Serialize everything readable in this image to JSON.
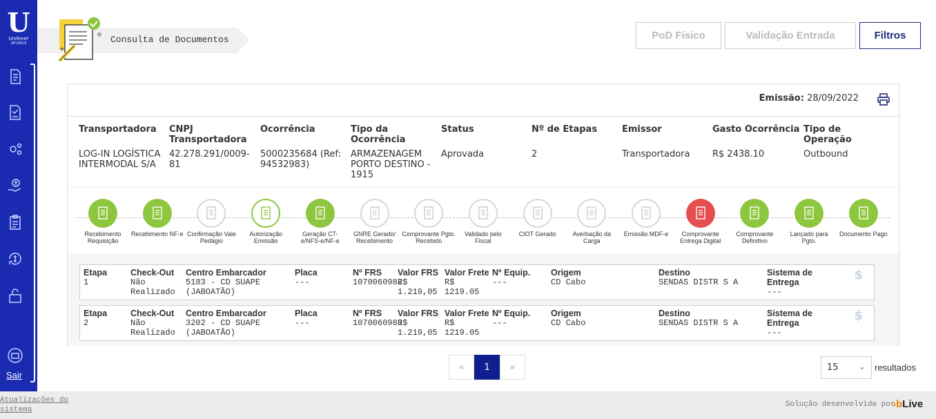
{
  "brand": {
    "name": "Unilever",
    "sub": "UP-DOCS",
    "letter": "U"
  },
  "sidebar": {
    "icons": [
      "document-icon",
      "document-check-icon",
      "gears-icon",
      "money-hand-icon",
      "clipboard-icon",
      "currency-cycle-icon",
      "unlock-icon",
      "robot-icon"
    ],
    "exit_label": "Sair"
  },
  "header": {
    "breadcrumb": "Consulta de Documentos",
    "buttons": {
      "pod": "PoD Físico",
      "validacao": "Validação Entrada",
      "filtros": "Filtros"
    }
  },
  "emission": {
    "label": "Emissão:",
    "value": "28/09/2022"
  },
  "info": [
    {
      "h": "Transportadora",
      "v": "LOG-IN LOGÍSTICA INTERMODAL S/A"
    },
    {
      "h": "CNPJ Transportadora",
      "v": "42.278.291/0009-81"
    },
    {
      "h": "Ocorrência",
      "v": "5000235684 (Ref: 94532983)"
    },
    {
      "h": "Tipo da Ocorrência",
      "v": "ARMAZENAGEM PORTO DESTINO - 1915"
    },
    {
      "h": "Status",
      "v": "Aprovada"
    },
    {
      "h": "Nº de Etapas",
      "v": "2"
    },
    {
      "h": "Emissor",
      "v": "Transportadora"
    },
    {
      "h": "Gasto Ocorrência",
      "v": "R$ 2438.10"
    },
    {
      "h": "Tipo de Operação",
      "v": "Outbound"
    }
  ],
  "steps": [
    {
      "label": "Recebimento Requisição",
      "state": "done"
    },
    {
      "label": "Recebimento NF-e",
      "state": "done"
    },
    {
      "label": "Confirmação Vale Pedágio",
      "state": "todo"
    },
    {
      "label": "Autorização Emissão",
      "state": "current"
    },
    {
      "label": "Geração CT-e/NFS-e/NF-e",
      "state": "done"
    },
    {
      "label": "GNRE Gerado/ Recebimento",
      "state": "todo"
    },
    {
      "label": "Comprovante Pgto. Recebido",
      "state": "todo"
    },
    {
      "label": "Validado pelo Fiscal",
      "state": "todo"
    },
    {
      "label": "CIOT Gerado",
      "state": "todo"
    },
    {
      "label": "Averbação da Carga",
      "state": "todo"
    },
    {
      "label": "Emissão MDF-e",
      "state": "todo"
    },
    {
      "label": "Comprovante Entrega Digital",
      "state": "alert"
    },
    {
      "label": "Comprovante Definitivo",
      "state": "done"
    },
    {
      "label": "Lançado para Pgto.",
      "state": "done"
    },
    {
      "label": "Documento Pago",
      "state": "done"
    }
  ],
  "stages": [
    {
      "etapa_h": "Etapa",
      "etapa": "1",
      "checkout_h": "Check-Out",
      "checkout": "Não Realizado",
      "centro_h": "Centro Embarcador",
      "centro": "5183 - CD SUAPE (JABOATÃO)",
      "placa_h": "Placa",
      "placa": "---",
      "frs_h": "Nº FRS",
      "frs": "1070060982",
      "valor_frs_h": "Valor FRS",
      "valor_frs": "R$ 1.219,05",
      "valor_frete_h": "Valor Frete",
      "valor_frete": "R$ 1219.05",
      "equip_h": "Nº Equip.",
      "equip": "---",
      "origem_h": "Origem",
      "origem": "CD Cabo",
      "destino_h": "Destino",
      "destino": "SENDAS DISTR S A",
      "sistema_h": "Sistema de Entrega",
      "sistema": "---"
    },
    {
      "etapa_h": "Etapa",
      "etapa": "2",
      "checkout_h": "Check-Out",
      "checkout": "Não Realizado",
      "centro_h": "Centro Embarcador",
      "centro": "3202 - CD SUAPE (JABOATÃO)",
      "placa_h": "Placa",
      "placa": "---",
      "frs_h": "Nº FRS",
      "frs": "1070060983",
      "valor_frs_h": "Valor FRS",
      "valor_frs": "R$ 1.219,05",
      "valor_frete_h": "Valor Frete",
      "valor_frete": "R$ 1219.05",
      "equip_h": "Nº Equip.",
      "equip": "---",
      "origem_h": "Origem",
      "origem": "CD Cabo",
      "destino_h": "Destino",
      "destino": "SENDAS DISTR S A",
      "sistema_h": "Sistema de Entrega",
      "sistema": "---"
    }
  ],
  "pagination": {
    "prev": "«",
    "current": "1",
    "next": "»",
    "per_page": "15",
    "results_label": "resultados"
  },
  "footer": {
    "updates": "Atualizações do sistema",
    "developed_by": "Solução desenvolvida por",
    "vendor": "Live",
    "vendor_mark": "›b"
  },
  "colors": {
    "sidebar": "#1a2bb2",
    "done": "#8dc63f",
    "alert": "#e54f4f",
    "active_page": "#0f1f8f"
  }
}
